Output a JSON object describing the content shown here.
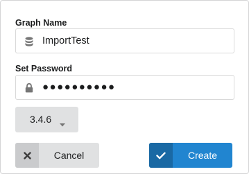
{
  "form": {
    "graph_name_label": "Graph Name",
    "graph_name_value": "ImportTest",
    "graph_name_icon": "database-icon",
    "password_label": "Set Password",
    "password_value": "●●●●●●●●●●",
    "password_icon": "lock-icon",
    "version_selected": "3.4.6",
    "version_icon": "caret-down-icon"
  },
  "actions": {
    "cancel_label": "Cancel",
    "cancel_icon": "close-icon",
    "create_label": "Create",
    "create_icon": "check-icon"
  },
  "colors": {
    "primary": "#2185d0",
    "primary_dark": "#1a69a4",
    "secondary": "#e0e1e2",
    "secondary_dark": "#cacbcd",
    "icon_gray": "#767676"
  }
}
